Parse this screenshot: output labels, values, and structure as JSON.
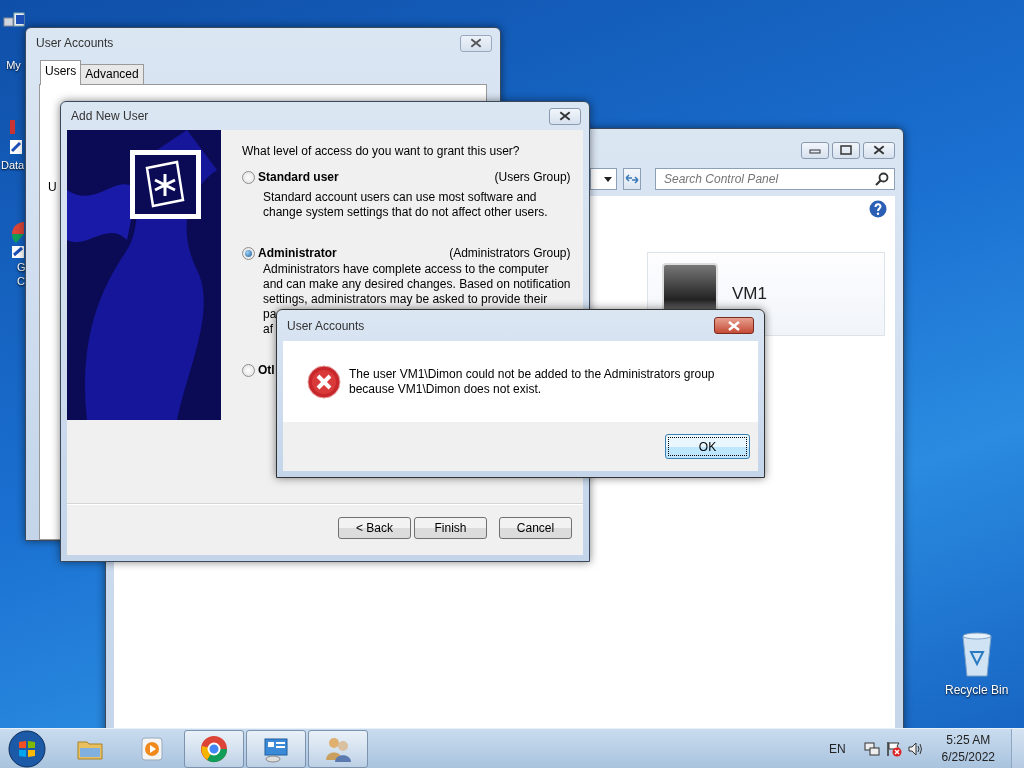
{
  "desktop_icons": [
    {
      "kind": "computer",
      "lines": [
        "My"
      ]
    },
    {
      "kind": "shortcut",
      "lines": [
        "Data"
      ]
    },
    {
      "kind": "browser-shortcut",
      "lines": [
        "G",
        "C"
      ]
    },
    {
      "kind": "recycle",
      "lines": [
        "Recycle Bin"
      ]
    }
  ],
  "control_panel_window": {
    "search": {
      "placeholder": "Search Control Panel"
    },
    "user_card": {
      "name": "VM1"
    }
  },
  "user_accounts_window": {
    "title": "User Accounts",
    "tabs": [
      {
        "label": "Users",
        "selected": true
      },
      {
        "label": "Advanced",
        "selected": false
      }
    ],
    "text_fragment": "U"
  },
  "add_user_dialog": {
    "title": "Add New User",
    "question": "What level of access do you want to grant this user?",
    "options": [
      {
        "label": "Standard user",
        "group": "(Users Group)",
        "description": [
          "Standard account users can use most software and",
          "change system settings that do not affect other users."
        ],
        "selected": false
      },
      {
        "label": "Administrator",
        "group": "(Administrators Group)",
        "description": [
          "Administrators have complete access to the computer",
          "and can make any desired changes. Based on notification",
          "settings, administrators may be asked to provide their"
        ],
        "fragments": [
          "pa",
          "af"
        ],
        "selected": true
      },
      {
        "label": "Otl",
        "selected": false
      }
    ],
    "buttons": [
      "< Back",
      "Finish",
      "Cancel"
    ]
  },
  "error_dialog": {
    "title": "User Accounts",
    "message_lines": [
      "The user VM1\\Dimon could not be added to the Administrators group",
      "because VM1\\Dimon does not exist."
    ],
    "button": "OK"
  },
  "taskbar": {
    "items": [
      {
        "kind": "explorer",
        "active": false
      },
      {
        "kind": "media",
        "active": false
      },
      {
        "kind": "chrome",
        "active": true
      },
      {
        "kind": "control-panel",
        "active": true
      },
      {
        "kind": "users",
        "active": true
      }
    ],
    "language": "EN",
    "time": "5:25 AM",
    "date": "6/25/2022"
  }
}
